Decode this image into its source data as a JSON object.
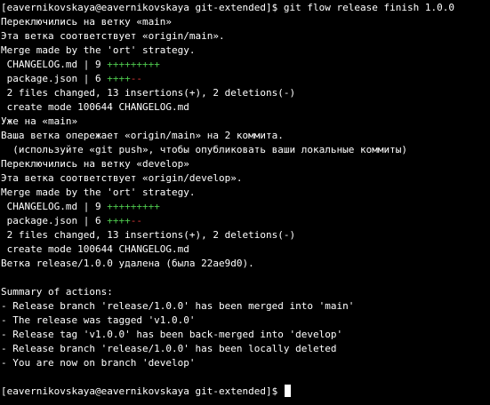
{
  "terminal": {
    "lines": [
      "[eavernikovskaya@eavernikovskaya git-extended]$ git flow release finish 1.0.0",
      "Переключились на ветку «main»",
      "Эта ветка соответствует «origin/main».",
      "Merge made by the 'ort' strategy.",
      " CHANGELOG.md | 9 ",
      " package.json | 6 ",
      " 2 files changed, 13 insertions(+), 2 deletions(-)",
      " create mode 100644 CHANGELOG.md",
      "Уже на «main»",
      "Ваша ветка опережает «origin/main» на 2 коммита.",
      "  (используйте «git push», чтобы опубликовать ваши локальные коммиты)",
      "Переключились на ветку «develop»",
      "Эта ветка соответствует «origin/develop».",
      "Merge made by the 'ort' strategy.",
      " CHANGELOG.md | 9 ",
      " package.json | 6 ",
      " 2 files changed, 13 insertions(+), 2 deletions(-)",
      " create mode 100644 CHANGELOG.md",
      "Ветка release/1.0.0 удалена (была 22ae9d0).",
      "",
      "Summary of actions:",
      "- Release branch 'release/1.0.0' has been merged into 'main'",
      "- The release was tagged 'v1.0.0'",
      "- Release tag 'v1.0.0' has been back-merged into 'develop'",
      "- Release branch 'release/1.0.0' has been locally deleted",
      "- You are now on branch 'develop'",
      "",
      "[eavernikovskaya@eavernikovskaya git-extended]$ "
    ],
    "diffstat": {
      "changelog_plus": "+++++++++",
      "package_plus": "++++",
      "package_minus": "--"
    },
    "colors": {
      "background": "#000000",
      "foreground": "#ffffff",
      "insertions": "#4ec94e",
      "deletions": "#e03c3c"
    }
  }
}
